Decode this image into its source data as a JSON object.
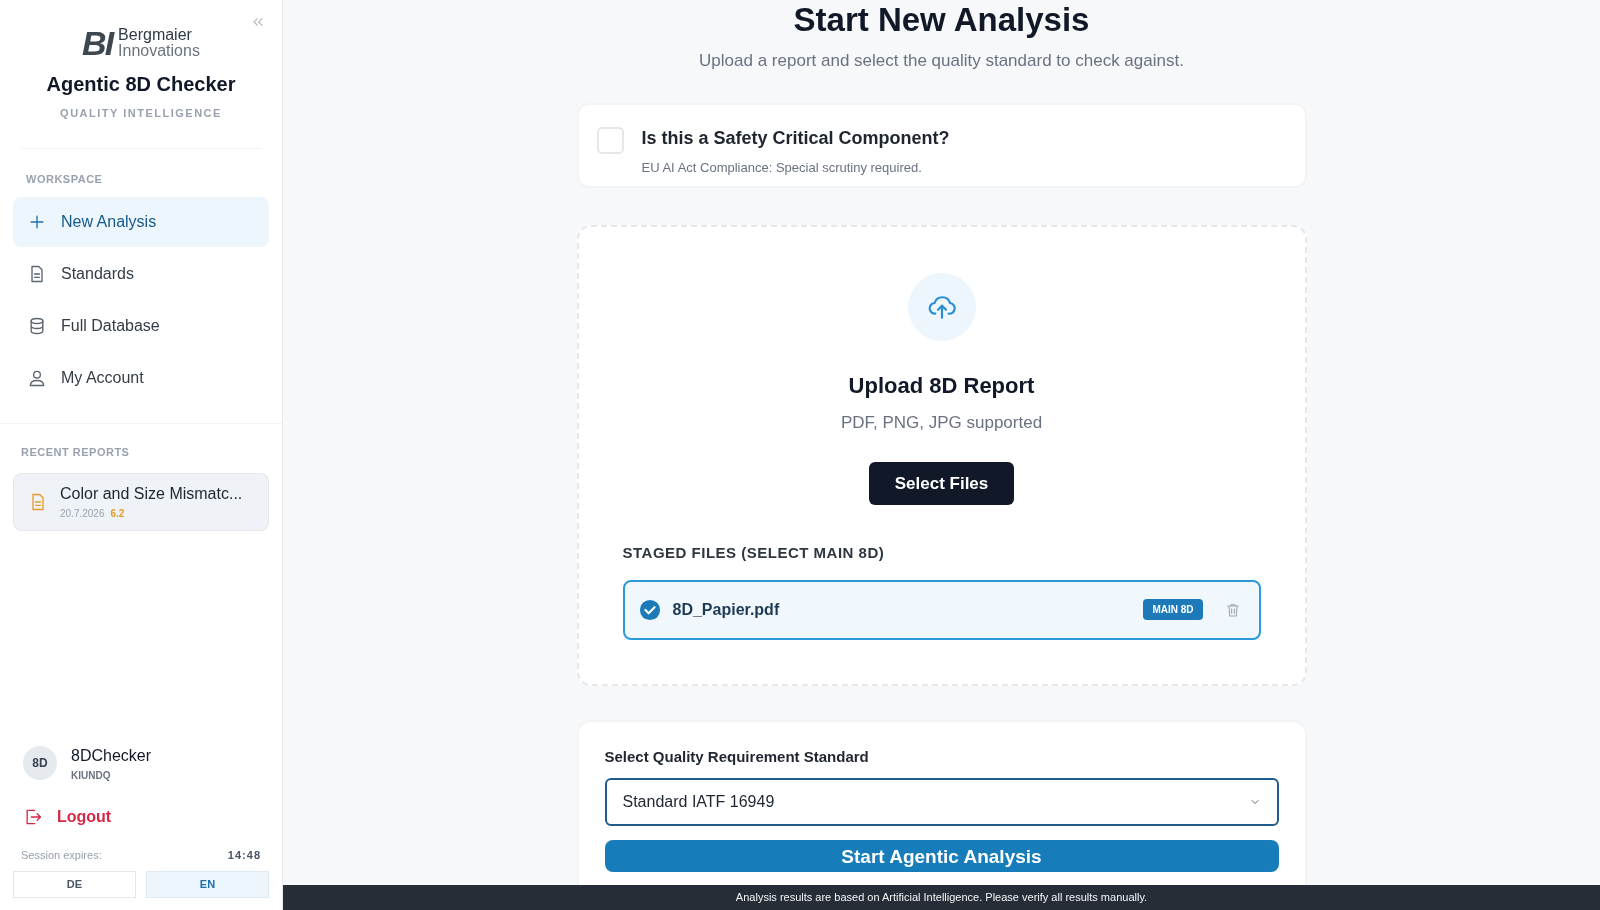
{
  "sidebar": {
    "logo": {
      "mark": "BI",
      "line_1": "Bergmaier",
      "line_2": "Innovations"
    },
    "app_title": "Agentic 8D Checker",
    "app_subtitle": "QUALITY INTELLIGENCE",
    "workspace": {
      "heading": "WORKSPACE",
      "items": [
        {
          "label": "New Analysis",
          "selected": true
        },
        {
          "label": "Standards",
          "selected": false
        },
        {
          "label": "Full Database",
          "selected": false
        },
        {
          "label": "My Account",
          "selected": false
        }
      ]
    },
    "recent": {
      "heading": "RECENT REPORTS",
      "items": [
        {
          "title": "Color and Size Mismatc...",
          "date": "20.7.2026",
          "score": "6.2"
        }
      ]
    },
    "user": {
      "avatar": "8D",
      "name": "8DChecker",
      "org": "KIUNDQ"
    },
    "logout": "Logout",
    "session_label": "Session expires:",
    "session_time": "14:48",
    "languages": [
      {
        "label": "DE",
        "selected": false
      },
      {
        "label": "EN",
        "selected": true
      }
    ]
  },
  "main": {
    "title": "Start New Analysis",
    "subtitle": "Upload a report and select the quality standard to check against.",
    "safety": {
      "checked": false,
      "question": "Is this a Safety Critical Component?",
      "note": "EU AI Act Compliance: Special scrutiny required."
    },
    "upload": {
      "title": "Upload 8D Report",
      "formats": "PDF, PNG, JPG supported",
      "button": "Select Files",
      "staged_heading": "STAGED FILES (SELECT MAIN 8D)",
      "files": [
        {
          "name": "8D_Papier.pdf",
          "selected": true,
          "badge": "MAIN 8D"
        }
      ]
    },
    "standard": {
      "label": "Select Quality Requirement Standard",
      "value": "Standard IATF 16949"
    },
    "start_button": "Start Agentic Analysis"
  },
  "footer": "Analysis results are based on Artificial Intelligence. Please verify all results manually."
}
